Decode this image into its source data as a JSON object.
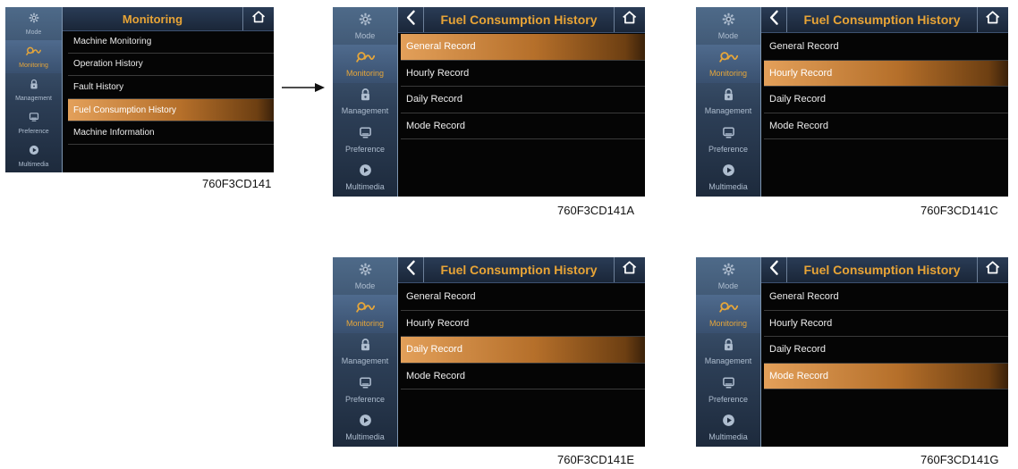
{
  "sidebar": {
    "items": [
      {
        "label": "Mode",
        "icon": "gear-icon"
      },
      {
        "label": "Monitoring",
        "icon": "monitoring-icon"
      },
      {
        "label": "Management",
        "icon": "lock-icon"
      },
      {
        "label": "Preference",
        "icon": "monitor-icon"
      },
      {
        "label": "Multimedia",
        "icon": "play-icon"
      }
    ],
    "active": "Monitoring"
  },
  "screens": [
    {
      "title": "Monitoring",
      "items": [
        "Machine Monitoring",
        "Operation History",
        "Fault History",
        "Fuel Consumption History",
        "Machine Information"
      ],
      "selected": 3,
      "caption": "760F3CD141"
    },
    {
      "title": "Fuel Consumption History",
      "items": [
        "General Record",
        "Hourly Record",
        "Daily Record",
        "Mode Record"
      ],
      "selected": 0,
      "caption": "760F3CD141A"
    },
    {
      "title": "Fuel Consumption History",
      "items": [
        "General Record",
        "Hourly Record",
        "Daily Record",
        "Mode Record"
      ],
      "selected": 1,
      "caption": "760F3CD141C"
    },
    {
      "title": "Fuel Consumption History",
      "items": [
        "General Record",
        "Hourly Record",
        "Daily Record",
        "Mode Record"
      ],
      "selected": 2,
      "caption": "760F3CD141E"
    },
    {
      "title": "Fuel Consumption History",
      "items": [
        "General Record",
        "Hourly Record",
        "Daily Record",
        "Mode Record"
      ],
      "selected": 3,
      "caption": "760F3CD141G"
    }
  ],
  "colors": {
    "accent": "#e8a436",
    "selection": "#c27a35",
    "sidebar": "#3b526e",
    "screen_bg": "#050505"
  }
}
